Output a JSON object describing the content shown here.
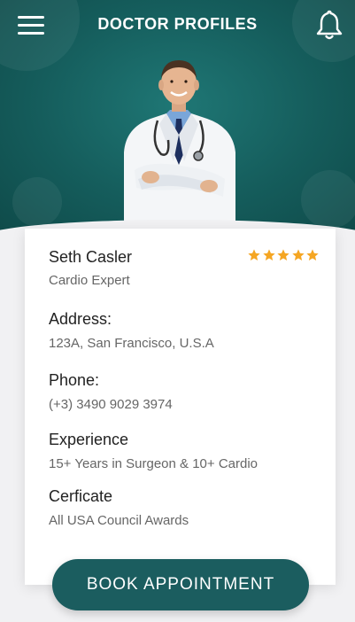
{
  "header": {
    "title": "DOCTOR PROFILES",
    "menu_icon": "hamburger-menu-icon",
    "notification_icon": "bell-icon",
    "background_color": "#155d5c"
  },
  "doctor": {
    "name": "Seth Casler",
    "specialty": "Cardio Expert",
    "rating": 5,
    "rating_max": 5,
    "star_color": "#f5a623",
    "fields": [
      {
        "label": "Address:",
        "value": "123A, San Francisco, U.S.A"
      },
      {
        "label": "Phone:",
        "value": "(+3) 3490 9029 3974"
      },
      {
        "label": "Experience",
        "value": "15+ Years in Surgeon & 10+ Cardio"
      },
      {
        "label": "Cerficate",
        "value": "All USA Council Awards"
      }
    ]
  },
  "actions": {
    "book_label": "BOOK APPOINTMENT",
    "button_color": "#1b5d5f"
  }
}
